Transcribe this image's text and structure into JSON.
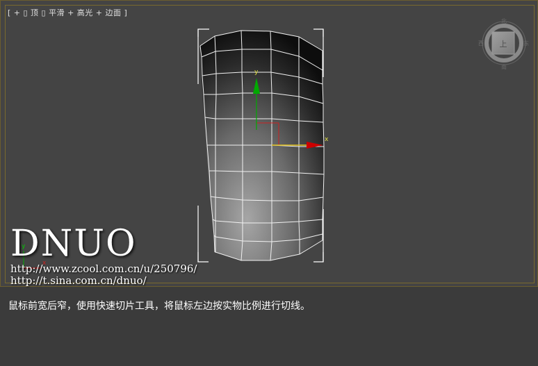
{
  "viewport": {
    "label": "[ + ▯ 顶 ▯ 平滑 + 高光 + 边面 ]",
    "axis_x": "x",
    "axis_y": "y",
    "viewcube": {
      "face": "上",
      "north": "北",
      "south": "南",
      "east": "东",
      "west": "西"
    }
  },
  "watermark": {
    "logo": "DNUO",
    "url1": "http://www.zcool.com.cn/u/250796/",
    "url2": "http://t.sina.com.cn/dnuo/"
  },
  "caption": "鼠标前宽后窄，使用快速切片工具，将鼠标左边按实物比例进行切线。",
  "colors": {
    "viewport_border": "#7a6a2e",
    "axis_x": "#cc0000",
    "axis_y": "#00aa00",
    "selection_brackets": "#ffffff"
  }
}
